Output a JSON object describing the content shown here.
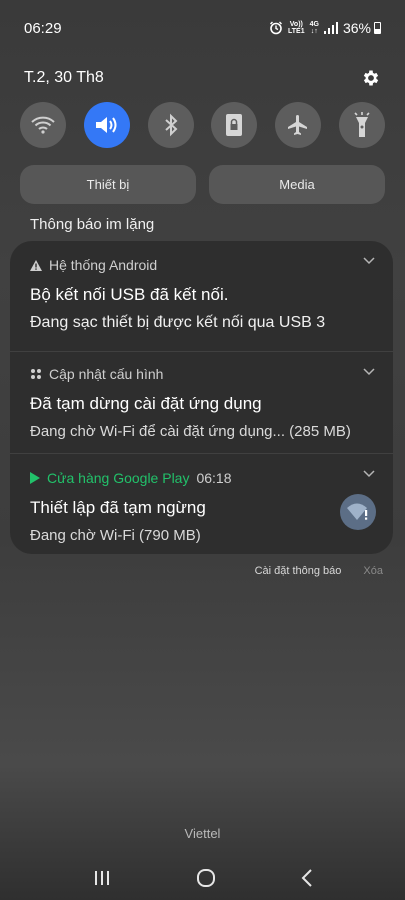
{
  "status_bar": {
    "time": "06:29",
    "volte_top": "Vo))",
    "volte_bottom": "LTE1",
    "network_top": "4G",
    "network_bottom": "↓↑",
    "battery_percent": "36%",
    "battery_level": 0.36,
    "icons": [
      "alarm-icon",
      "signal-icon",
      "battery-icon"
    ]
  },
  "header": {
    "date": "T.2, 30 Th8",
    "settings_icon": "gear-icon"
  },
  "quick_settings": [
    {
      "icon": "wifi-icon",
      "active": false
    },
    {
      "icon": "sound-icon",
      "active": true
    },
    {
      "icon": "bluetooth-icon",
      "active": false
    },
    {
      "icon": "rotation-lock-icon",
      "active": false
    },
    {
      "icon": "airplane-icon",
      "active": false
    },
    {
      "icon": "flashlight-icon",
      "active": false
    }
  ],
  "media_buttons": {
    "device": "Thiết bị",
    "media": "Media"
  },
  "notifications_section": {
    "title": "Thông báo im lặng"
  },
  "notifications": [
    {
      "app": "Hệ thống Android",
      "title": "Bộ kết nối USB đã kết nối.",
      "body": "Đang sạc thiết bị được kết nối qua USB 3"
    },
    {
      "app": "Cập nhật cấu hình",
      "title": "Đã tạm dừng cài đặt ứng dụng",
      "body": "Đang chờ Wi-Fi để cài đặt ứng dụng... (285 MB)"
    },
    {
      "app": "Cửa hàng Google Play",
      "time": "06:18",
      "title": "Thiết lập đã tạm ngừng",
      "body": "Đang chờ Wi-Fi (790 MB)"
    }
  ],
  "notification_actions": {
    "settings": "Cài đặt thông báo",
    "clear": "Xóa"
  },
  "carrier": "Viettel",
  "colors": {
    "accent": "#3478f6",
    "google_play_green": "#22c16a"
  }
}
